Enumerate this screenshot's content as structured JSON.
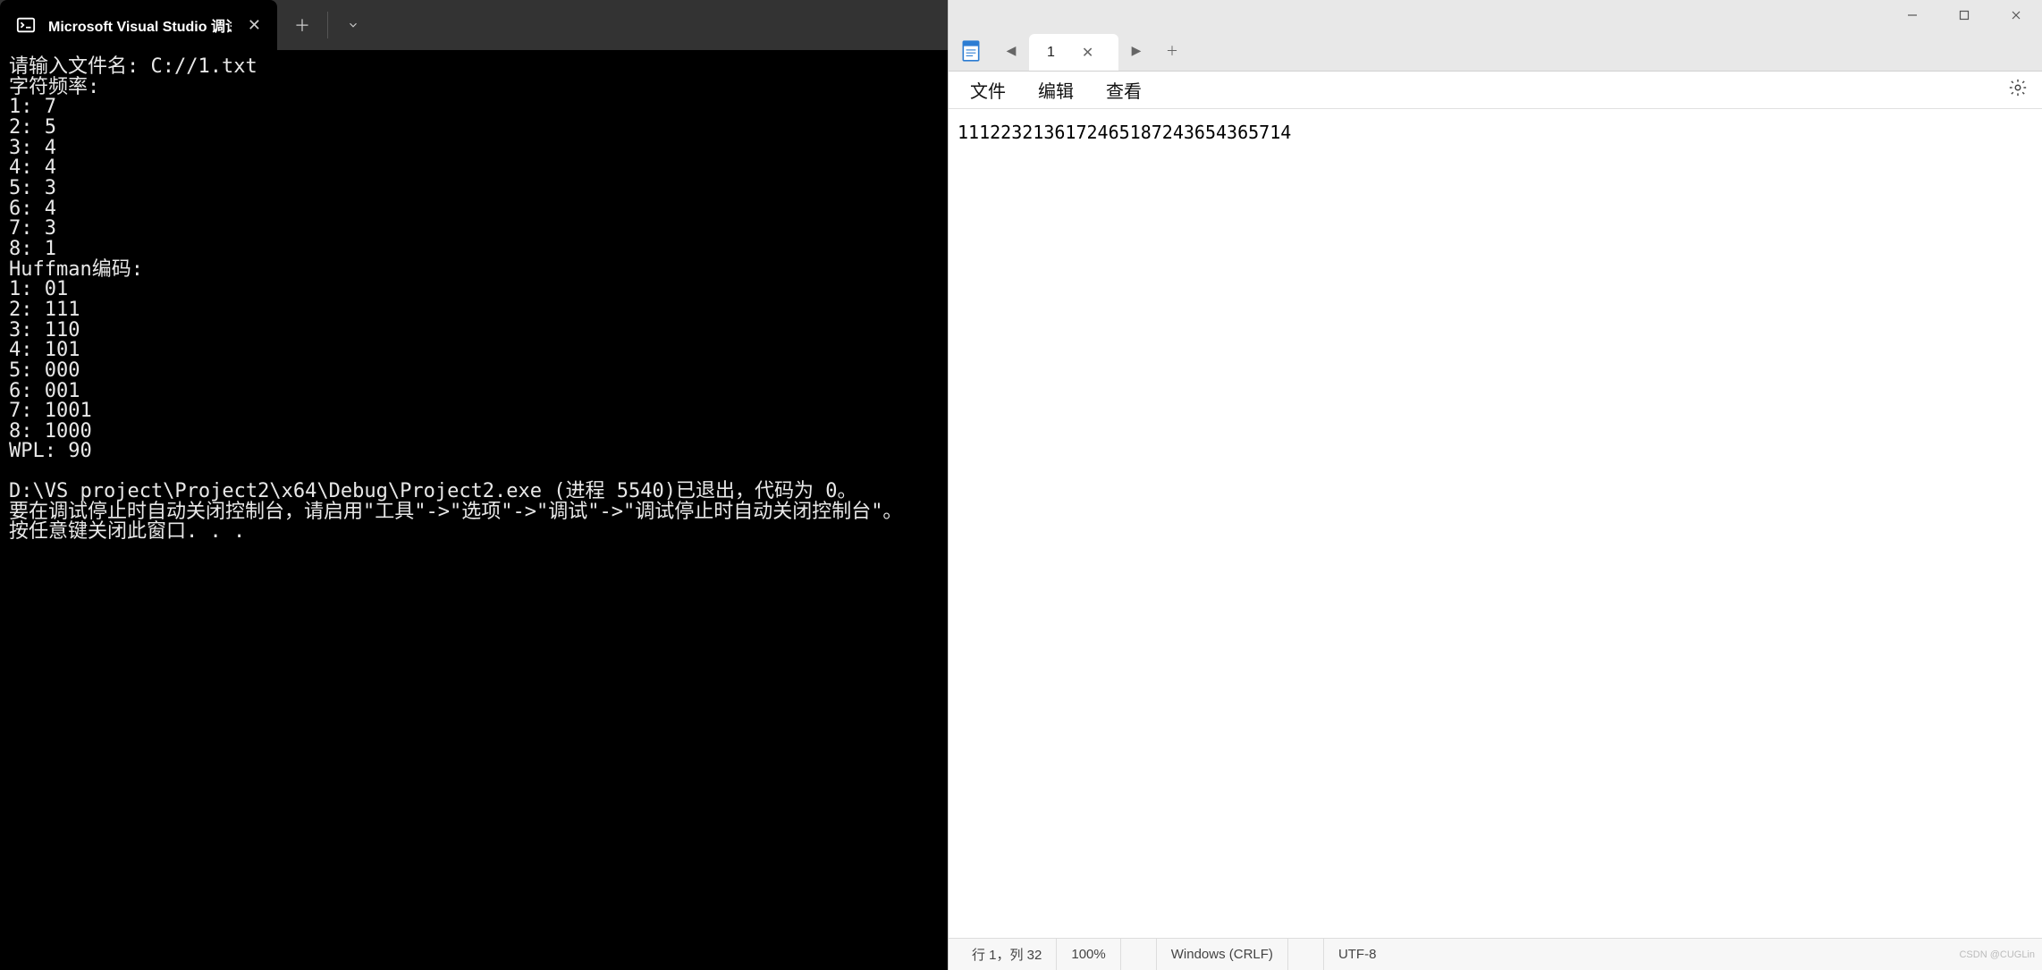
{
  "console": {
    "tab_title": "Microsoft Visual Studio 调试控",
    "lines": [
      "请输入文件名: C://1.txt",
      "字符频率:",
      "1: 7",
      "2: 5",
      "3: 4",
      "4: 4",
      "5: 3",
      "6: 4",
      "7: 3",
      "8: 1",
      "Huffman编码:",
      "1: 01",
      "2: 111",
      "3: 110",
      "4: 101",
      "5: 000",
      "6: 001",
      "7: 1001",
      "8: 1000",
      "WPL: 90"
    ],
    "footer_lines": [
      "D:\\VS project\\Project2\\x64\\Debug\\Project2.exe (进程 5540)已退出，代码为 0。",
      "要在调试停止时自动关闭控制台，请启用\"工具\"->\"选项\"->\"调试\"->\"调试停止时自动关闭控制台\"。",
      "按任意键关闭此窗口. . ."
    ]
  },
  "notepad": {
    "tab_label": "1",
    "menu": {
      "file": "文件",
      "edit": "编辑",
      "view": "查看"
    },
    "content": "1112232136172465187243654365714",
    "status": {
      "pos": "行 1，列 32",
      "zoom": "100%",
      "eol": "Windows (CRLF)",
      "enc": "UTF-8"
    }
  },
  "watermark": "CSDN @CUGLin"
}
